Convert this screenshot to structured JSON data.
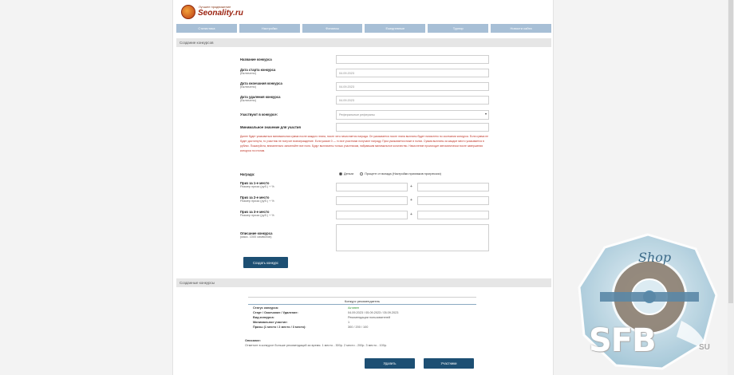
{
  "logo": {
    "name": "Seonality.ru",
    "tagline": "Лучшее продвижение"
  },
  "nav": [
    "Статистика",
    "Настройки",
    "Финансы",
    "Ежедневные",
    "Турнир",
    "Новости сайта"
  ],
  "create_section": "Создание конкурсов",
  "form": {
    "name_label": "Название конкурса",
    "start_label": "Дата старта конкурса",
    "start_sub": "(Включено)",
    "start_value": "04.09.2023",
    "end_label": "Дата окончания конкурса",
    "end_sub": "(Включено)",
    "end_value": "04.09.2023",
    "delete_label": "Дата удаления конкурса",
    "delete_sub": "(Включено)",
    "delete_value": "04.09.2023",
    "participants_label": "Участвуют в конкурсе:",
    "participants_value": "Реферальные рефералы",
    "min_label": "Минимальное значение для участия",
    "warning": "Далее будет указываться минимальная сумма после каждого этапа, после чего начисляется награда. Он указывается после этапа выплаты будет начислено по окончании конкурса. Если сумма не будет достигнута, то участник не получит вознаграждение. Если указан 0 — то все участники получают награду. Приз указывается ниже в полях. Сумма выплаты за каждое место указывается в рублях. Пожалуйста, внимательно заполняйте все поля. Будут выплачены только участникам, набравшим минимальное количество. Начисление происходит автоматически после завершения конкурса по итогам.",
    "reward_label": "Награда:",
    "reward_money": "Деньги",
    "reward_bonus": "Процент от вклада (Настройки признаков прогрессии)",
    "prize1_label": "Приз за 1-е место",
    "prize2_label": "Приз за 2-е место",
    "prize3_label": "Приз за 3-е место",
    "prize_sub": "Размер приза (руб.) + %",
    "desc_label": "Описание конкурса",
    "desc_sub": "(макс. 1000 символов)",
    "create_btn": "Создать конкурс"
  },
  "created_section": "Созданные конкурсы",
  "card": {
    "title": "Конкурс рекомендатель",
    "rows": [
      {
        "k": "Статус конкурса:",
        "v": "Активен"
      },
      {
        "k": "Старт / Окончание / Удаление:",
        "v": "04.09.2023 / 05.09.2023 / 05.09.2023"
      },
      {
        "k": "Вид конкурса:",
        "v": "Рекомендации пользователей"
      },
      {
        "k": "Минимальное участие:",
        "v": "1"
      },
      {
        "k": "Призы (1 место / 2 место / 3 место):",
        "v": "300 / 200 / 100"
      }
    ],
    "desc_label": "Описание:",
    "desc_text": "Отметьте в конкурсе больше рекомендаций за время. 1 место - 300р. 2 место - 200р. 3 место - 100р.",
    "delete_btn": "Удалить",
    "details_btn": "Участники"
  },
  "watermark": {
    "shop": "Shop",
    "brand": "SFB",
    "tld": "SU"
  }
}
